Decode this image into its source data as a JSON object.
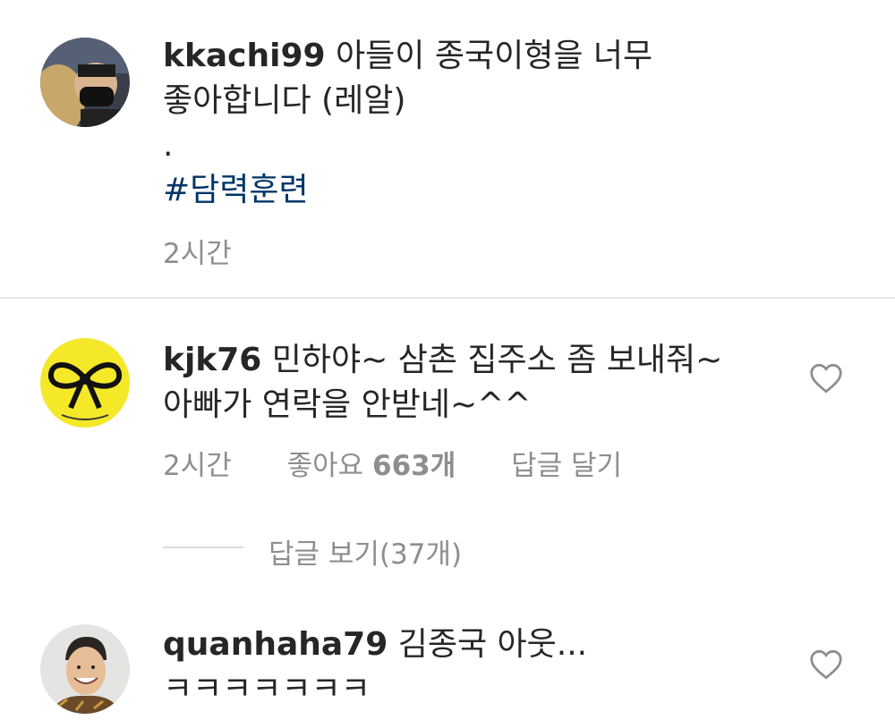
{
  "caption": {
    "username": "kkachi99",
    "text_line1": " 아들이 종국이형을 너무",
    "text_line2": "좋아합니다 (레알)",
    "dot": ".",
    "hashtag": "#담력훈련",
    "time": "2시간"
  },
  "comments": [
    {
      "username": "kjk76",
      "text_line1": " 민하야~ 삼촌 집주소 좀 보내줘~",
      "text_line2": "아빠가 연락을 안받네~^^",
      "time": "2시간",
      "likes_label": "좋아요",
      "likes_count": "663개",
      "reply_label": "답글 달기",
      "view_replies": "답글 보기(37개)"
    },
    {
      "username": "quanhaha79",
      "text_line1": " 김종국 아웃...",
      "text_line2": "ㅋㅋㅋㅋㅋㅋㅋ"
    }
  ],
  "icons": {
    "like": "heart-outline-icon"
  },
  "colors": {
    "hashtag": "#003569",
    "muted": "#8e8e8e",
    "text": "#262626"
  }
}
